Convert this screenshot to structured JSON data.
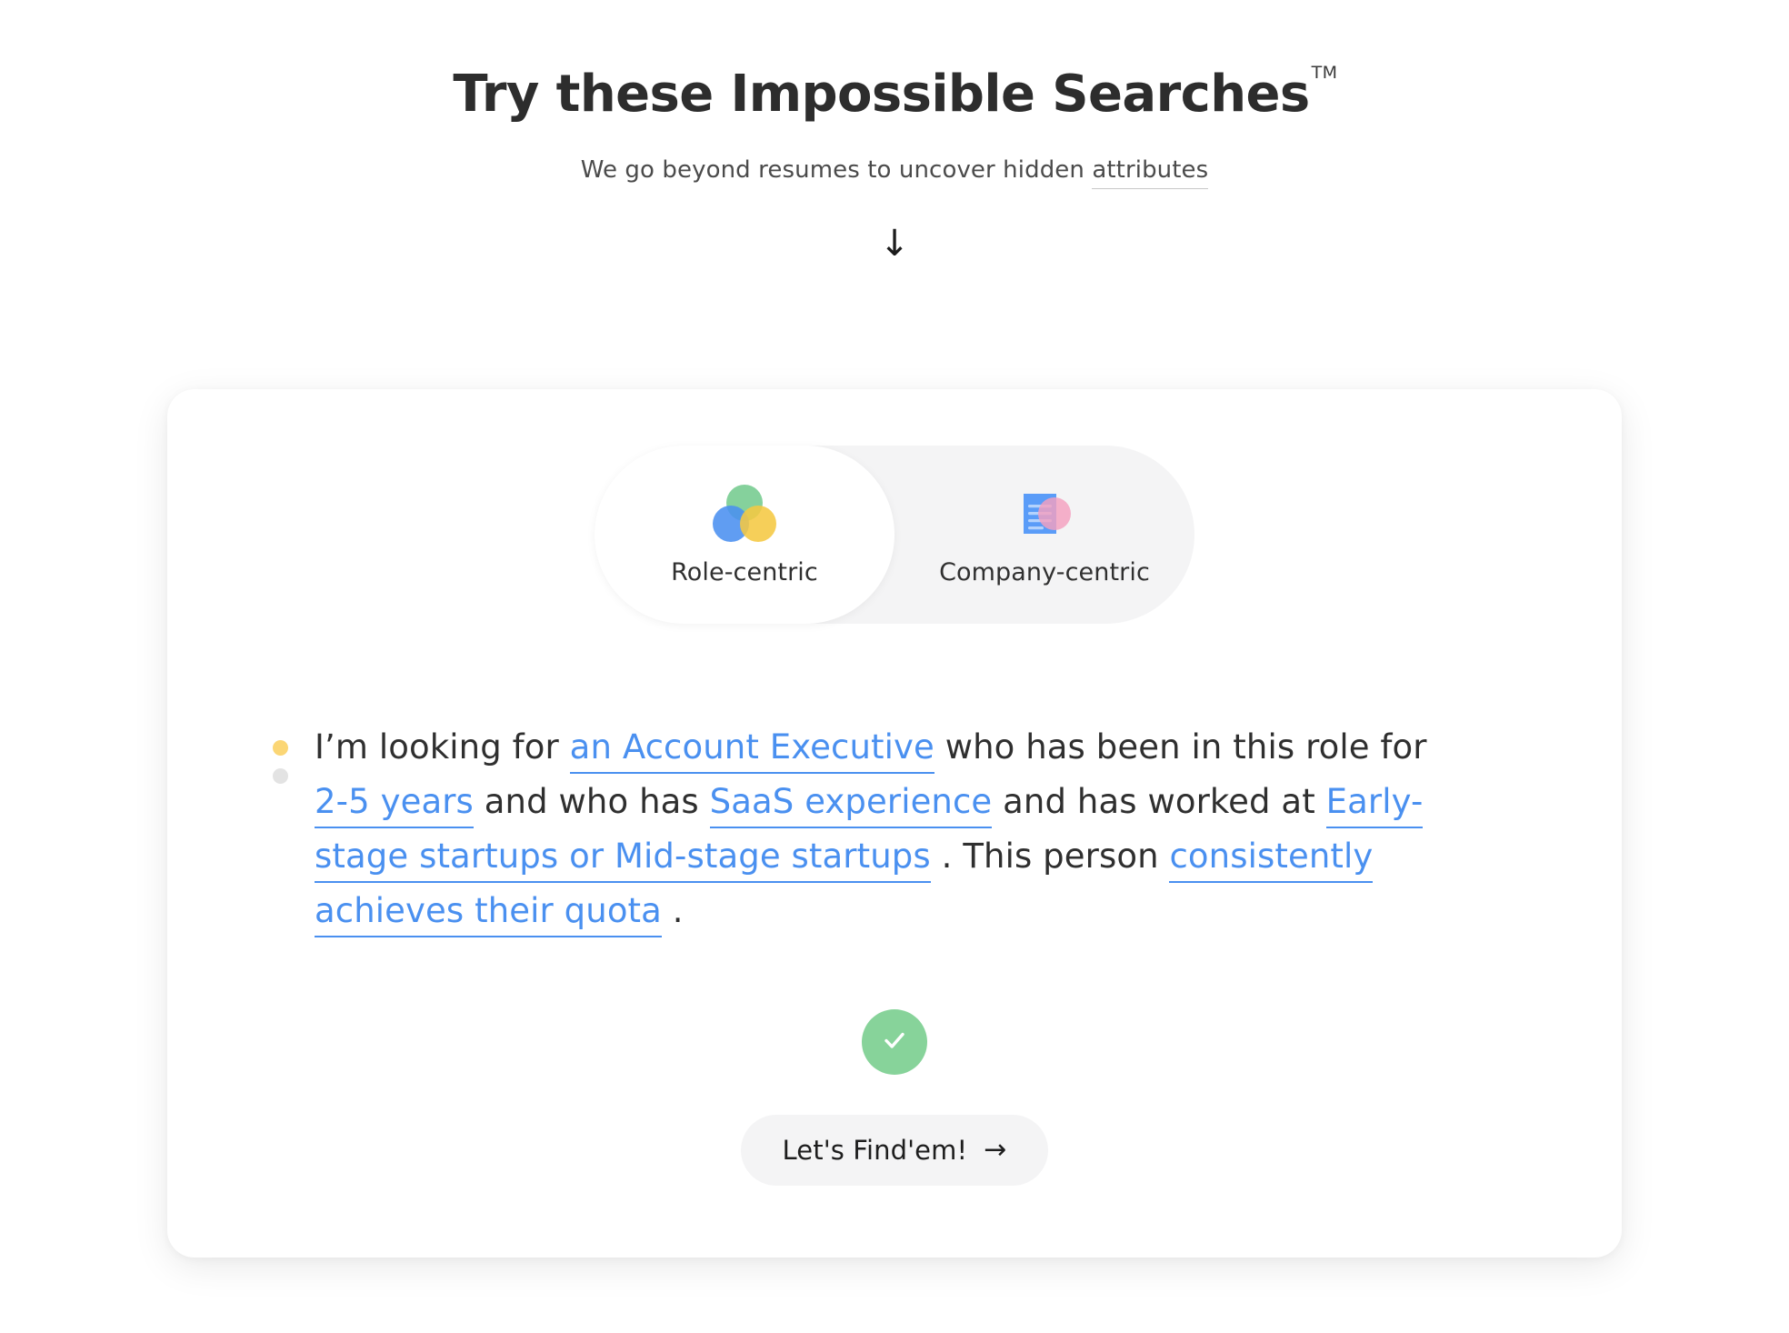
{
  "hero": {
    "title": "Try these Impossible Searches",
    "trademark": "TM",
    "subtitle_prefix": "We go beyond resumes to uncover hidden ",
    "subtitle_highlight": "attributes",
    "arrow_icon": "↓"
  },
  "toggle": {
    "options": [
      {
        "label": "Role-centric",
        "icon": "venn-circles-icon",
        "active": true
      },
      {
        "label": "Company-centric",
        "icon": "document-circle-icon",
        "active": false
      }
    ]
  },
  "sentence": {
    "parts": [
      {
        "type": "text",
        "value": "I’m looking for "
      },
      {
        "type": "chip",
        "value": "an Account Executive"
      },
      {
        "type": "text",
        "value": " who has been in this role for "
      },
      {
        "type": "chip",
        "value": "2-5 years"
      },
      {
        "type": "text",
        "value": " and who has "
      },
      {
        "type": "chip",
        "value": "SaaS experience"
      },
      {
        "type": "text",
        "value": " and has worked at "
      },
      {
        "type": "chip",
        "value": "Early-stage startups or Mid-stage startups"
      },
      {
        "type": "text",
        "value": " . This person "
      },
      {
        "type": "chip",
        "value": "consistently achieves their quota"
      },
      {
        "type": "text",
        "value": " ."
      }
    ],
    "t0": "I’m looking for ",
    "c0": "an Account Executive",
    "t1": " who has been in this role for ",
    "c1": "2-5 years",
    "t2": " and who has ",
    "c2": "SaaS experience",
    "t3": " and has worked at ",
    "c3": "Early-stage startups or Mid-stage startups",
    "t4": " . This person ",
    "c4": "consistently achieves their quota",
    "t5": " ."
  },
  "status": {
    "check_icon": "check-icon",
    "color": "#87d39a"
  },
  "cta": {
    "label": "Let's Find'em!",
    "arrow": "→"
  },
  "colors": {
    "link": "#4a90f0",
    "bullet_active": "#fbd675",
    "bullet_inactive": "#e3e3e3",
    "card_bg": "#ffffff",
    "toggle_bg": "#f4f4f5",
    "success": "#87d39a"
  }
}
